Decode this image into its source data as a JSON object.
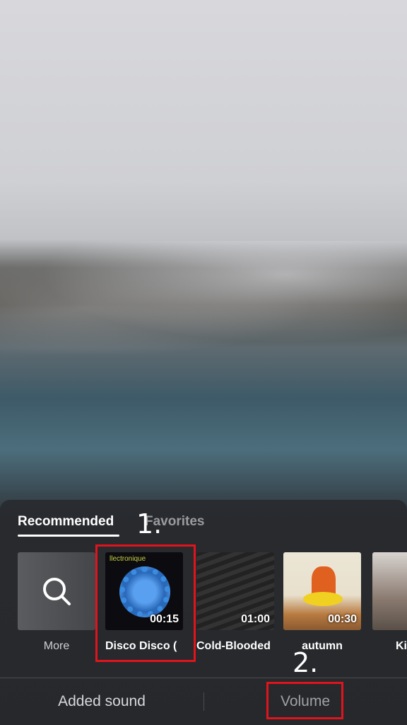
{
  "tabs": [
    {
      "label": "Recommended",
      "active": true
    },
    {
      "label": "Favorites",
      "active": false
    }
  ],
  "sounds": [
    {
      "label": "More",
      "icon": "search-icon"
    },
    {
      "label": "Disco Disco (",
      "duration": "00:15",
      "cover_text": "llectronique"
    },
    {
      "label": "Cold-Blooded",
      "duration": "01:00"
    },
    {
      "label": "autumn",
      "duration": "00:30"
    },
    {
      "label": "Ki"
    }
  ],
  "bottom": {
    "added_sound": "Added sound",
    "volume": "Volume"
  },
  "annotations": {
    "step1": "1.",
    "step2": "2."
  },
  "colors": {
    "highlight": "#e0141c",
    "panel": "#282a2e"
  }
}
